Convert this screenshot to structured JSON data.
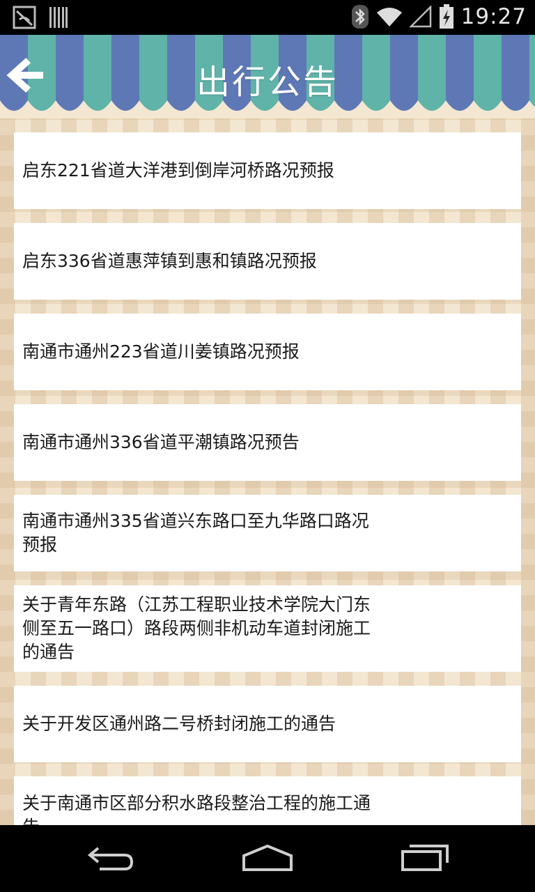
{
  "status_bar": {
    "time": "19:27",
    "icons": [
      "notification-app-icon",
      "barcode-icon",
      "bluetooth-icon",
      "wifi-icon",
      "signal-icon",
      "battery-charging-icon"
    ]
  },
  "header": {
    "title": "出行公告",
    "back_icon": "arrow-left-icon"
  },
  "notices": [
    {
      "title": "启东221省道大洋港到倒岸河桥路况预报"
    },
    {
      "title": "启东336省道惠萍镇到惠和镇路况预报"
    },
    {
      "title": "南通市通州223省道川姜镇路况预报"
    },
    {
      "title": "南通市通州336省道平潮镇路况预告"
    },
    {
      "title": "南通市通州335省道兴东路口至九华路口路况预报"
    },
    {
      "title": "关于青年东路（江苏工程职业技术学院大门东侧至五一路口）路段两侧非机动车道封闭施工的通告"
    },
    {
      "title": "关于开发区通州路二号桥封闭施工的通告"
    },
    {
      "title": "关于南通市区部分积水路段整治工程的施工通告"
    }
  ],
  "nav_bar": {
    "icons": [
      "back-nav-icon",
      "home-nav-icon",
      "recent-apps-icon"
    ]
  }
}
